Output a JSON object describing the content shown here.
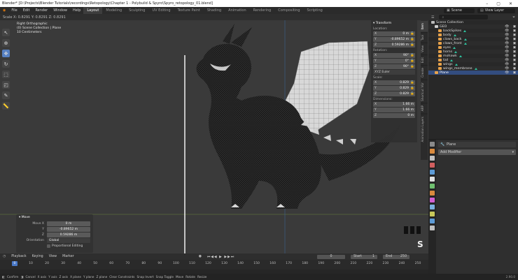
{
  "window": {
    "title": "Blender* [D:\\Projects\\Blender Tutorials\\recordings\\Retopology\\Chapter 1 - Polybuild & Spyro\\Spyro_retopology_01.blend]",
    "controls": [
      "–",
      "▢",
      "✕"
    ]
  },
  "top_menu": {
    "items": [
      "File",
      "Edit",
      "Render",
      "Window",
      "Help"
    ],
    "workspaces": [
      "Layout",
      "Modeling",
      "Sculpting",
      "UV Editing",
      "Texture Paint",
      "Shading",
      "Animation",
      "Rendering",
      "Compositing",
      "Scripting"
    ],
    "active_workspace": "Layout",
    "scene_label": "Scene",
    "view_layer_label": "View Layer"
  },
  "viewport_header": {
    "scale_readout": "Scale X: 0.8291  Y: 0.8291  Z: 0.8291"
  },
  "viewport": {
    "view_name": "Right Orthographic",
    "collection_info": "(0) Scene Collection | Plane",
    "units_info": "10 Centimeters"
  },
  "n_panel": {
    "header": "Transform",
    "location_label": "Location:",
    "location": [
      {
        "axis": "X",
        "value": "0 m"
      },
      {
        "axis": "Y",
        "value": "-0.89652 m"
      },
      {
        "axis": "Z",
        "value": "0.59286 m"
      }
    ],
    "rotation_label": "Rotation:",
    "rotation": [
      {
        "axis": "X",
        "value": "90°"
      },
      {
        "axis": "Y",
        "value": "0°"
      },
      {
        "axis": "Z",
        "value": "90°"
      }
    ],
    "rotation_mode": "XYZ Euler",
    "scale_label": "Scale:",
    "scale": [
      {
        "axis": "X",
        "value": "0.829"
      },
      {
        "axis": "Y",
        "value": "0.829"
      },
      {
        "axis": "Z",
        "value": "0.829"
      }
    ],
    "dimensions_label": "Dimensions:",
    "dimensions": [
      {
        "axis": "X",
        "value": "1.66 m"
      },
      {
        "axis": "Y",
        "value": "1.66 m"
      },
      {
        "axis": "Z",
        "value": "0 m"
      }
    ],
    "tabs": [
      "Item",
      "Tool",
      "View",
      "Edit",
      "Create",
      "Shortcut VUr",
      "ARP",
      "Animation Layers"
    ]
  },
  "operator_panel": {
    "title": "Move",
    "move_label": "Move X",
    "y_label": "Y",
    "z_label": "Z",
    "x_value": "0 m",
    "y_value": "-0.89652 m",
    "z_value": "0.59286 m",
    "orientation_label": "Orientation",
    "orientation_value": "Global",
    "proportional_label": "Proportional Editing"
  },
  "timeline": {
    "menus": [
      "Playback",
      "Keying",
      "View",
      "Marker"
    ],
    "current_frame": "0",
    "start_label": "Start",
    "start_value": "1",
    "end_label": "End",
    "end_value": "250",
    "ticks": [
      "0",
      "10",
      "20",
      "30",
      "40",
      "50",
      "60",
      "70",
      "80",
      "90",
      "100",
      "110",
      "120",
      "130",
      "140",
      "150",
      "160",
      "170",
      "180",
      "190",
      "200",
      "210",
      "220",
      "230",
      "240",
      "250"
    ]
  },
  "status_bar": {
    "items": [
      "Confirm",
      "Cancel",
      "X axis",
      "Y axis",
      "Z axis",
      "X plane",
      "Y plane",
      "Z plane",
      "Clear Constraints",
      "Snap Invert",
      "Snap Toggle",
      "Move",
      "Rotate",
      "Resize"
    ],
    "version": "2.90.0"
  },
  "outliner": {
    "scene_collection": "Scene Collection",
    "items": [
      {
        "name": "GEO",
        "level": 1,
        "color": "#cfcfcf",
        "selected": false
      },
      {
        "name": "backSpikes",
        "level": 2,
        "color": "#e8a24a",
        "selected": false
      },
      {
        "name": "body",
        "level": 2,
        "color": "#e8a24a",
        "selected": false
      },
      {
        "name": "claws_back",
        "level": 2,
        "color": "#e8a24a",
        "selected": false
      },
      {
        "name": "claws_front",
        "level": 2,
        "color": "#e8a24a",
        "selected": false
      },
      {
        "name": "eyes",
        "level": 2,
        "color": "#e8a24a",
        "selected": false
      },
      {
        "name": "horns",
        "level": 2,
        "color": "#e8a24a",
        "selected": false
      },
      {
        "name": "mohawk",
        "level": 2,
        "color": "#e8a24a",
        "selected": false
      },
      {
        "name": "tail",
        "level": 2,
        "color": "#e8a24a",
        "selected": false
      },
      {
        "name": "wings",
        "level": 2,
        "color": "#e8a24a",
        "selected": false
      },
      {
        "name": "wings_membrane",
        "level": 2,
        "color": "#e8a24a",
        "selected": false
      },
      {
        "name": "Plane",
        "level": 1,
        "color": "#e8a24a",
        "selected": true
      }
    ]
  },
  "properties": {
    "object_name": "Plane",
    "add_modifier": "Add Modifier",
    "icon_colors": [
      "#8a8a8a",
      "#d98a3d",
      "#c0c0c0",
      "#d15f5f",
      "#5d9bd6",
      "#e0e0e0",
      "#6fbf6f",
      "#d98a3d",
      "#d15fd1",
      "#7cb0e0",
      "#c8c85a",
      "#5d9bd6",
      "#c0c0c0"
    ]
  }
}
